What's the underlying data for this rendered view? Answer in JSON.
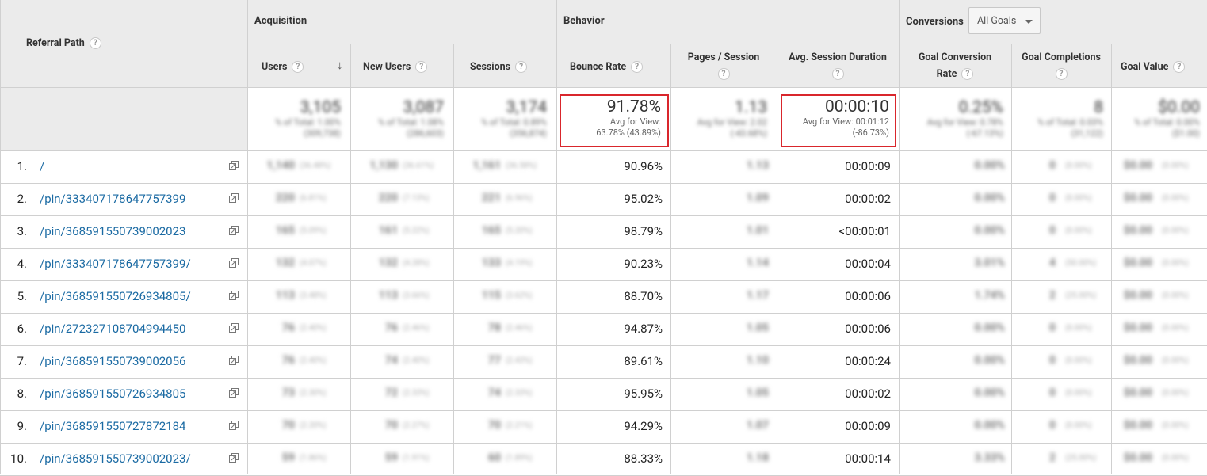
{
  "header": {
    "referral_path_label": "Referral Path",
    "help_glyph": "?",
    "sort_arrow": "↓",
    "groups": {
      "acquisition": "Acquisition",
      "behavior": "Behavior",
      "conversions": "Conversions"
    },
    "goal_select": {
      "value": "All Goals"
    },
    "columns": {
      "users": "Users",
      "new_users": "New Users",
      "sessions": "Sessions",
      "bounce_rate": "Bounce Rate",
      "pages_session": "Pages / Session",
      "avg_session_duration": "Avg. Session Duration",
      "goal_conversion_rate_l1": "Goal Conversion",
      "goal_conversion_rate_l2": "Rate",
      "goal_completions": "Goal Completions",
      "goal_value": "Goal Value"
    }
  },
  "summary": {
    "users": {
      "value": "3,105",
      "sub1": "% of Total: 1.00%",
      "sub2": "(309,738)"
    },
    "new_users": {
      "value": "3,087",
      "sub1": "% of Total: 1.08%",
      "sub2": "(286,603)"
    },
    "sessions": {
      "value": "3,174",
      "sub1": "% of Total: 0.89%",
      "sub2": "(356,874)"
    },
    "bounce_rate": {
      "value": "91.78%",
      "sub1": "Avg for View:",
      "sub2": "63.78% (43.89%)"
    },
    "pages_session": {
      "value": "1.13",
      "sub1": "Avg for View: 2.02",
      "sub2": "(-43.68%)"
    },
    "avg_session_duration": {
      "value": "00:00:10",
      "sub1": "Avg for View: 00:01:12",
      "sub2": "(-86.73%)"
    },
    "goal_conversion_rate": {
      "value": "0.25%",
      "sub1": "Avg for View: 0.78%",
      "sub2": "(-67.13%)"
    },
    "goal_completions": {
      "value": "8",
      "sub1": "% of Total: 0.03%",
      "sub2": "(31,122)"
    },
    "goal_value": {
      "value": "$0.00",
      "sub1": "% of Total: 0.00%",
      "sub2": "($1.00)"
    }
  },
  "rows": [
    {
      "num": "1.",
      "path": "/",
      "users": "1,140",
      "users_pct": "(36.48%)",
      "new_users": "1,130",
      "new_users_pct": "(36.61%)",
      "sessions": "1,161",
      "sessions_pct": "(36.58%)",
      "bounce_rate": "90.96%",
      "pages_session": "1.13",
      "duration": "00:00:09",
      "conv_rate": "0.00%",
      "completions": "0",
      "completions_pct": "(0.00%)",
      "goal_value": "$0.00",
      "goal_value_pct": "(0.00%)"
    },
    {
      "num": "2.",
      "path": "/pin/333407178647757399",
      "users": "220",
      "users_pct": "(6.81%)",
      "new_users": "220",
      "new_users_pct": "(7.13%)",
      "sessions": "221",
      "sessions_pct": "(6.96%)",
      "bounce_rate": "95.02%",
      "pages_session": "1.09",
      "duration": "00:00:02",
      "conv_rate": "0.00%",
      "completions": "0",
      "completions_pct": "(0.00%)",
      "goal_value": "$0.00",
      "goal_value_pct": "(0.00%)"
    },
    {
      "num": "3.",
      "path": "/pin/368591550739002023",
      "users": "165",
      "users_pct": "(5.09%)",
      "new_users": "161",
      "new_users_pct": "(5.22%)",
      "sessions": "165",
      "sessions_pct": "(5.20%)",
      "bounce_rate": "98.79%",
      "pages_session": "1.01",
      "duration": "<00:00:01",
      "conv_rate": "0.00%",
      "completions": "0",
      "completions_pct": "(0.00%)",
      "goal_value": "$0.00",
      "goal_value_pct": "(0.00%)"
    },
    {
      "num": "4.",
      "path": "/pin/333407178647757399/",
      "users": "132",
      "users_pct": "(4.07%)",
      "new_users": "132",
      "new_users_pct": "(4.28%)",
      "sessions": "133",
      "sessions_pct": "(4.19%)",
      "bounce_rate": "90.23%",
      "pages_session": "1.14",
      "duration": "00:00:04",
      "conv_rate": "3.01%",
      "completions": "4",
      "completions_pct": "(50.00%)",
      "goal_value": "$0.00",
      "goal_value_pct": "(0.00%)"
    },
    {
      "num": "5.",
      "path": "/pin/368591550726934805/",
      "users": "113",
      "users_pct": "(3.48%)",
      "new_users": "113",
      "new_users_pct": "(3.66%)",
      "sessions": "115",
      "sessions_pct": "(3.62%)",
      "bounce_rate": "88.70%",
      "pages_session": "1.17",
      "duration": "00:00:06",
      "conv_rate": "1.74%",
      "completions": "2",
      "completions_pct": "(25.00%)",
      "goal_value": "$0.00",
      "goal_value_pct": "(0.00%)"
    },
    {
      "num": "6.",
      "path": "/pin/272327108704994450",
      "users": "76",
      "users_pct": "(2.40%)",
      "new_users": "76",
      "new_users_pct": "(2.46%)",
      "sessions": "78",
      "sessions_pct": "(2.46%)",
      "bounce_rate": "94.87%",
      "pages_session": "1.05",
      "duration": "00:00:06",
      "conv_rate": "0.00%",
      "completions": "0",
      "completions_pct": "(0.00%)",
      "goal_value": "$0.00",
      "goal_value_pct": "(0.00%)"
    },
    {
      "num": "7.",
      "path": "/pin/368591550739002056",
      "users": "76",
      "users_pct": "(2.40%)",
      "new_users": "74",
      "new_users_pct": "(2.40%)",
      "sessions": "77",
      "sessions_pct": "(2.43%)",
      "bounce_rate": "89.61%",
      "pages_session": "1.10",
      "duration": "00:00:24",
      "conv_rate": "0.00%",
      "completions": "0",
      "completions_pct": "(0.00%)",
      "goal_value": "$0.00",
      "goal_value_pct": "(0.00%)"
    },
    {
      "num": "8.",
      "path": "/pin/368591550726934805",
      "users": "73",
      "users_pct": "(2.30%)",
      "new_users": "72",
      "new_users_pct": "(2.33%)",
      "sessions": "74",
      "sessions_pct": "(2.33%)",
      "bounce_rate": "95.95%",
      "pages_session": "1.05",
      "duration": "00:00:02",
      "conv_rate": "0.00%",
      "completions": "0",
      "completions_pct": "(0.00%)",
      "goal_value": "$0.00",
      "goal_value_pct": "(0.00%)"
    },
    {
      "num": "9.",
      "path": "/pin/368591550727872184",
      "users": "70",
      "users_pct": "(2.20%)",
      "new_users": "70",
      "new_users_pct": "(2.27%)",
      "sessions": "70",
      "sessions_pct": "(2.21%)",
      "bounce_rate": "94.29%",
      "pages_session": "1.07",
      "duration": "00:00:09",
      "conv_rate": "0.00%",
      "completions": "0",
      "completions_pct": "(0.00%)",
      "goal_value": "$0.00",
      "goal_value_pct": "(0.00%)"
    },
    {
      "num": "10.",
      "path": "/pin/368591550739002023/",
      "users": "59",
      "users_pct": "(1.86%)",
      "new_users": "59",
      "new_users_pct": "(1.91%)",
      "sessions": "60",
      "sessions_pct": "(1.89%)",
      "bounce_rate": "88.33%",
      "pages_session": "1.18",
      "duration": "00:00:14",
      "conv_rate": "3.33%",
      "completions": "2",
      "completions_pct": "(25.00%)",
      "goal_value": "$0.00",
      "goal_value_pct": "(0.00%)"
    }
  ]
}
